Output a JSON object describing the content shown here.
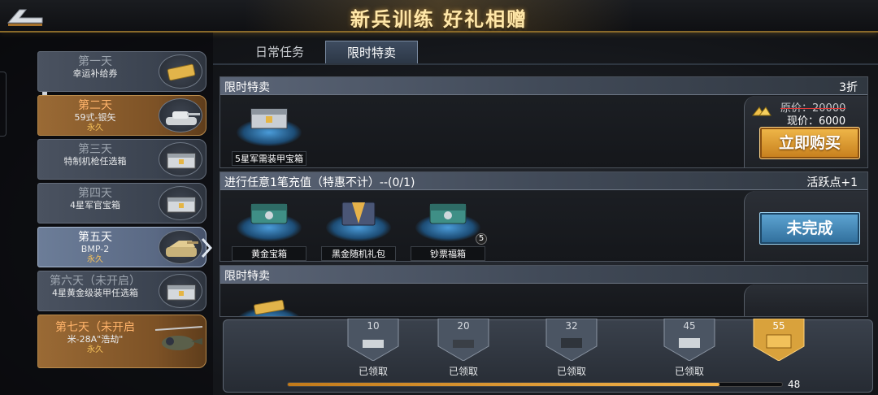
{
  "header": {
    "title": "新兵训练 好礼相赠",
    "back_icon": "back-arrow-icon"
  },
  "days": [
    {
      "title": "第一天",
      "reward": "幸运补给券",
      "perm": "",
      "state": "claimed",
      "icon": "ticket-icon"
    },
    {
      "title": "第二天",
      "reward": "59式-银矢",
      "perm": "永久",
      "state": "active",
      "icon": "tank-icon"
    },
    {
      "title": "第三天",
      "reward": "特制机枪任选箱",
      "perm": "",
      "state": "claimed",
      "icon": "crate-icon"
    },
    {
      "title": "第四天",
      "reward": "4星军官宝箱",
      "perm": "",
      "state": "claimed",
      "icon": "crate-icon"
    },
    {
      "title": "第五天",
      "reward": "BMP-2",
      "perm": "永久",
      "state": "selected",
      "icon": "tank-icon"
    },
    {
      "title": "第六天（未开启）",
      "reward": "4星黄金级装甲任选箱",
      "perm": "",
      "state": "locked",
      "icon": "crate-icon"
    },
    {
      "title": "第七天（未开启",
      "reward": "米-28A\"浩劫\"",
      "perm": "永久",
      "state": "locked-highlight",
      "icon": "helicopter-icon"
    }
  ],
  "tabs": [
    {
      "label": "日常任务",
      "active": false
    },
    {
      "label": "限时特卖",
      "active": true
    }
  ],
  "cards": [
    {
      "title": "限时特卖",
      "right": "3折",
      "items": [
        {
          "label": "5星军需装甲宝箱"
        }
      ],
      "original_price": "原价：20000",
      "current_price": "现价：6000",
      "button": "立即购买",
      "currency_icon": "gold-icon"
    },
    {
      "title": "进行任意1笔充值（特惠不计）--(0/1)",
      "right": "活跃点+1",
      "items": [
        {
          "label": "黄金宝箱"
        },
        {
          "label": "黑金随机礼包"
        },
        {
          "label": "钞票福箱",
          "count": "5"
        }
      ],
      "button": "未完成"
    },
    {
      "title": "限时特卖"
    }
  ],
  "milestones": [
    {
      "points": "10",
      "status": "已领取"
    },
    {
      "points": "20",
      "status": "已领取"
    },
    {
      "points": "32",
      "status": "已领取"
    },
    {
      "points": "45",
      "status": "已领取"
    },
    {
      "points": "55",
      "status": ""
    }
  ],
  "progress": {
    "value": "48",
    "max": "55",
    "fraction": 0.873
  },
  "colors": {
    "gold": "#f0b84a",
    "blue_button": "#3f86b8",
    "accent": "#ffe7a8"
  }
}
